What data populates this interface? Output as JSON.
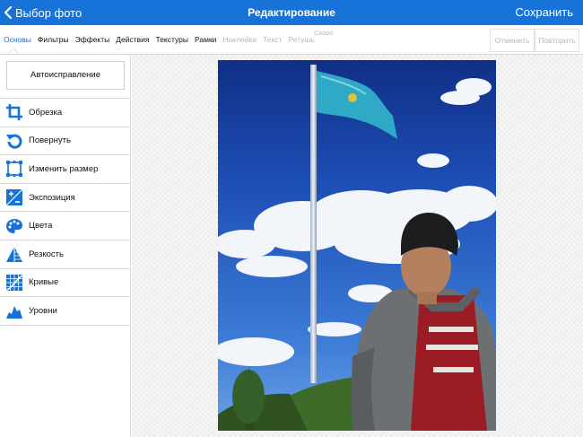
{
  "navbar": {
    "back_label": "Выбор фото",
    "title": "Редактирование",
    "save_label": "Сохранить"
  },
  "toolbar": {
    "tabs": [
      {
        "label": "Основы",
        "state": "active"
      },
      {
        "label": "Фильтры",
        "state": "normal"
      },
      {
        "label": "Эффекты",
        "state": "normal"
      },
      {
        "label": "Действия",
        "state": "normal"
      },
      {
        "label": "Текстуры",
        "state": "normal"
      },
      {
        "label": "Рамки",
        "state": "normal"
      },
      {
        "label": "Наклейки",
        "state": "disabled"
      },
      {
        "label": "Текст",
        "state": "disabled"
      },
      {
        "label": "Ретушь",
        "state": "disabled"
      }
    ],
    "soon_label": "Скоро",
    "undo_label": "Отменить",
    "redo_label": "Повторить"
  },
  "sidebar": {
    "auto_label": "Автоисправление",
    "tools": [
      {
        "label": "Обрезка",
        "icon": "crop-icon"
      },
      {
        "label": "Повернуть",
        "icon": "rotate-icon"
      },
      {
        "label": "Изменить размер",
        "icon": "resize-icon"
      },
      {
        "label": "Экспозиция",
        "icon": "exposure-icon"
      },
      {
        "label": "Цвета",
        "icon": "palette-icon"
      },
      {
        "label": "Резкость",
        "icon": "sharpness-icon"
      },
      {
        "label": "Кривые",
        "icon": "curves-icon"
      },
      {
        "label": "Уровни",
        "icon": "levels-icon"
      }
    ]
  },
  "colors": {
    "accent": "#1672d6",
    "disabled": "#b8b8b8"
  }
}
